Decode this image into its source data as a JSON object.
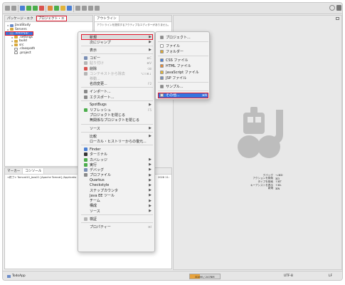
{
  "explorer": {
    "tabs": [
      "パッケージ・エク",
      "プロジェクト・エ"
    ],
    "tree": [
      {
        "label": "JavaStudy",
        "kind": "proj",
        "twisty": "▸",
        "indent": 0
      },
      {
        "label": "Servers",
        "kind": "folder",
        "twisty": "▸",
        "indent": 0
      },
      {
        "label": "TodoApp",
        "kind": "proj",
        "twisty": "▾",
        "indent": 0,
        "selected": true
      },
      {
        "label": ".settings",
        "kind": "folder",
        "twisty": "▸",
        "indent": 1
      },
      {
        "label": "build",
        "kind": "folder",
        "twisty": "▸",
        "indent": 1
      },
      {
        "label": "src",
        "kind": "folder",
        "twisty": "▸",
        "indent": 1
      },
      {
        "label": ".classpath",
        "kind": "file",
        "twisty": "",
        "indent": 1
      },
      {
        "label": ".project",
        "kind": "file",
        "twisty": "",
        "indent": 1
      }
    ]
  },
  "outline": {
    "tab": "アウトライン",
    "message": "アウトラインを提供するアクティブなエディターがありません。"
  },
  "console": {
    "tabs": [
      "マーカー",
      "コンソール"
    ],
    "line": "<終了> Tomcat10_Java21 [Apache Tomcat] /Applicatio",
    "line_tail": "2026 11:"
  },
  "editor": {
    "prefs": [
      {
        "key": "デバッグ",
        "value": "⌥⌘D"
      },
      {
        "key": "アクションを検索",
        "value": "⌘3"
      },
      {
        "key": "タイプを検索",
        "value": "⇧⌘T"
      },
      {
        "key": "キーアシストを表示",
        "value": "⇧⌘L"
      },
      {
        "key": "新規",
        "value": "⌘N"
      }
    ]
  },
  "context_menu": {
    "items": [
      {
        "type": "item",
        "label": "新規",
        "arrow": "▶",
        "state": "active",
        "icon": ""
      },
      {
        "type": "item",
        "label": "次にジャンプ",
        "arrow": "▶"
      },
      {
        "type": "sep"
      },
      {
        "type": "item",
        "label": "表示",
        "arrow": "▶"
      },
      {
        "type": "sep"
      },
      {
        "type": "item",
        "label": "コピー",
        "shortcut": "⌘C",
        "icon": "#7a8fb5"
      },
      {
        "type": "item",
        "label": "貼り付け",
        "shortcut": "⌘V",
        "state": "disabled",
        "icon": "#b5b5b5"
      },
      {
        "type": "item",
        "label": "削除",
        "shortcut": "⌫",
        "icon": "#d9534f"
      },
      {
        "type": "item",
        "label": "コンテキストから除去",
        "shortcut": "⌥⇧⌘↓",
        "state": "disabled",
        "icon": "#b5b5b5"
      },
      {
        "type": "item",
        "label": "移動...",
        "state": "disabled"
      },
      {
        "type": "item",
        "label": "名前変更...",
        "shortcut": "F2"
      },
      {
        "type": "sep"
      },
      {
        "type": "item",
        "label": "インポート...",
        "icon": "#8a8a8a"
      },
      {
        "type": "item",
        "label": "エクスポート...",
        "icon": "#8a8a8a"
      },
      {
        "type": "sep"
      },
      {
        "type": "item",
        "label": "SpotBugs",
        "arrow": "▶"
      },
      {
        "type": "item",
        "label": "リフレッシュ",
        "shortcut": "F5",
        "icon": "#4cae4c"
      },
      {
        "type": "item",
        "label": "プロジェクトを閉じる"
      },
      {
        "type": "item",
        "label": "無関係なプロジェクトを閉じる"
      },
      {
        "type": "sep"
      },
      {
        "type": "item",
        "label": "ソース",
        "arrow": "▶"
      },
      {
        "type": "sep"
      },
      {
        "type": "item",
        "label": "比較",
        "arrow": "▶"
      },
      {
        "type": "item",
        "label": "ローカル・ヒストリーからの復元..."
      },
      {
        "type": "sep"
      },
      {
        "type": "item",
        "label": "Finder",
        "icon": "#4a7fd4"
      },
      {
        "type": "item",
        "label": "ターミナル",
        "icon": "#333333"
      },
      {
        "type": "item",
        "label": "カバレッジ",
        "arrow": "▶",
        "icon": "#4cae4c"
      },
      {
        "type": "item",
        "label": "実行",
        "arrow": "▶",
        "icon": "#4cae4c"
      },
      {
        "type": "item",
        "label": "デバッグ",
        "arrow": "▶",
        "icon": "#7a8fb5"
      },
      {
        "type": "item",
        "label": "プロファイル",
        "arrow": "▶",
        "icon": "#8a8a8a"
      },
      {
        "type": "item",
        "label": "Quarkus",
        "arrow": "▶"
      },
      {
        "type": "item",
        "label": "Checkstyle",
        "arrow": "▶"
      },
      {
        "type": "item",
        "label": "ステップカウンタ",
        "arrow": "▶"
      },
      {
        "type": "item",
        "label": "Java EE ツール",
        "arrow": "▶"
      },
      {
        "type": "item",
        "label": "チーム",
        "arrow": "▶"
      },
      {
        "type": "item",
        "label": "構成",
        "arrow": "▶"
      },
      {
        "type": "item",
        "label": "ソース",
        "arrow": "▶"
      },
      {
        "type": "sep"
      },
      {
        "type": "item",
        "label": "検証",
        "icon": "#b5b5b5"
      },
      {
        "type": "sep"
      },
      {
        "type": "item",
        "label": "プロパティー",
        "shortcut": "⌘I"
      }
    ]
  },
  "new_submenu": {
    "items": [
      {
        "type": "item",
        "label": "プロジェクト...",
        "icon": "#8a8a8a"
      },
      {
        "type": "sep"
      },
      {
        "type": "item",
        "label": "ファイル",
        "icon": "#ffffff"
      },
      {
        "type": "item",
        "label": "フォルダー",
        "icon": "#d9a93b"
      },
      {
        "type": "sep"
      },
      {
        "type": "item",
        "label": "CSS ファイル",
        "icon": "#4a7fd4"
      },
      {
        "type": "item",
        "label": "HTML ファイル",
        "icon": "#e08a3a"
      },
      {
        "type": "item",
        "label": "JavaScript ファイル",
        "icon": "#e0b43a"
      },
      {
        "type": "item",
        "label": "JSP ファイル",
        "icon": "#7a8fb5"
      },
      {
        "type": "sep"
      },
      {
        "type": "item",
        "label": "サンプル...",
        "icon": "#8a8a8a"
      },
      {
        "type": "sep"
      },
      {
        "type": "item",
        "label": "その他...",
        "shortcut": "⌘N",
        "state": "selected",
        "icon": "#e0e0e0"
      }
    ]
  },
  "status": {
    "project": "TodoApp",
    "memory": "816M / 2478M",
    "memory_fraction": 0.33,
    "encoding": "UTF-8",
    "eol": "LF"
  },
  "colors": {
    "selection": "#3574e0",
    "highlight_box": "#e0162b",
    "memory_fill": "#e8a33b"
  }
}
